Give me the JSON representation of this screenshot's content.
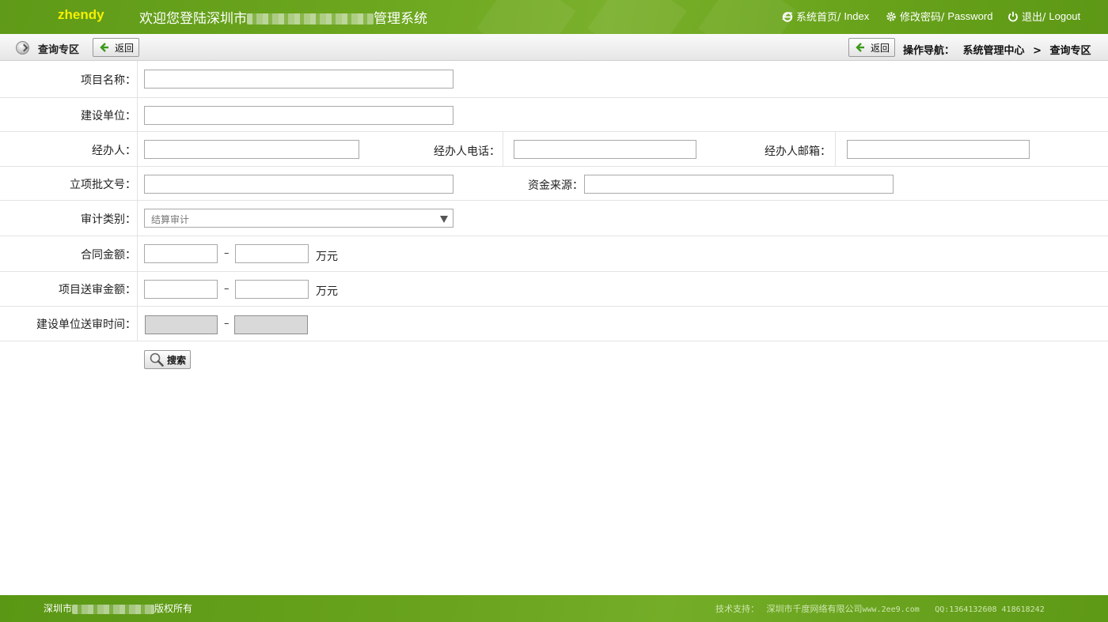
{
  "header": {
    "brand": "zhendy",
    "welcome_prefix": "欢迎您登陆深圳市",
    "welcome_suffix": "管理系统",
    "nav": [
      {
        "label": "系统首页/",
        "en": "Index",
        "icon": "ie-icon"
      },
      {
        "label": "修改密码/",
        "en": "Password",
        "icon": "gear-icon"
      },
      {
        "label": "退出/",
        "en": "Logout",
        "icon": "power-icon"
      }
    ]
  },
  "subbar": {
    "zone_title": "查询专区",
    "back_label": "返回",
    "nav_label": "操作导航：",
    "crumb_1": "系统管理中心",
    "crumb_sep": ">",
    "crumb_2": "查询专区"
  },
  "form": {
    "project_name_label": "项目名称：",
    "project_name_value": "",
    "build_unit_label": "建设单位：",
    "build_unit_value": "",
    "agent_label": "经办人：",
    "agent_value": "",
    "agent_phone_label": "经办人电话：",
    "agent_phone_value": "",
    "agent_email_label": "经办人邮箱：",
    "agent_email_value": "",
    "approval_no_label": "立项批文号：",
    "approval_no_value": "",
    "fund_source_label": "资金来源：",
    "fund_source_value": "",
    "audit_type_label": "审计类别：",
    "audit_type_selected": "结算审计",
    "contract_amount_label": "合同金额：",
    "contract_amount_from": "",
    "contract_amount_to": "",
    "range_dash": "–",
    "unit_wan": "万元",
    "submit_amount_label": "项目送审金额：",
    "submit_amount_from": "",
    "submit_amount_to": "",
    "submit_time_label": "建设单位送审时间：",
    "submit_time_from": "",
    "submit_time_to": "",
    "search_label": "搜索"
  },
  "footer": {
    "copyright_prefix": "深圳市",
    "copyright_suffix": "版权所有",
    "support_label": "技术支持：",
    "support_company": "深圳市千度网络有限公司",
    "support_site": "www.2ee9.com",
    "support_qq": "QQ:1364132608 418618242"
  },
  "colors": {
    "header_green": "#6aa41e",
    "brand_yellow": "#f6f000"
  }
}
